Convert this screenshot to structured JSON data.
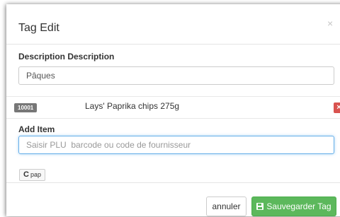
{
  "modal": {
    "title": "Tag Edit",
    "close_glyph": "×"
  },
  "description": {
    "label": "Description Description",
    "value": "Pâques"
  },
  "items": [
    {
      "code": "10001",
      "name": "Lays' Paprika chips 275g",
      "remove_glyph": "×",
      "remove_icon": "remove-icon"
    }
  ],
  "add_item": {
    "label": "Add Item",
    "placeholder": "Saisir PLU  barcode ou code de fournisseur"
  },
  "pap_button": {
    "icon": "refresh-icon",
    "glyph": "C",
    "label": "pap"
  },
  "footer": {
    "cancel_label": "annuler",
    "save_label": "Sauvegarder Tag",
    "save_icon": "floppy-disk-icon"
  },
  "colors": {
    "success": "#5cb85c",
    "danger": "#d9534f",
    "badge": "#777777",
    "focus_border": "#66afe9"
  }
}
